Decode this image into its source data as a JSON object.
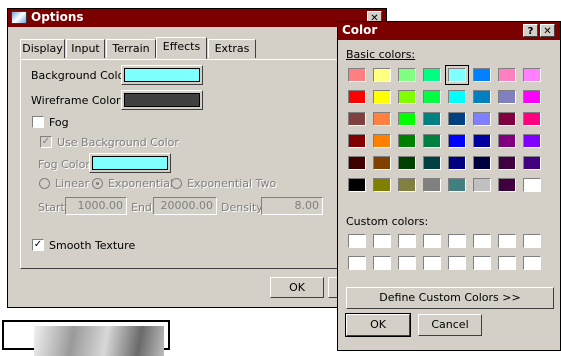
{
  "options_window": {
    "title": "Options",
    "close_glyph": "✕",
    "tabs": [
      {
        "label": "Display",
        "active": false
      },
      {
        "label": "Input",
        "active": false
      },
      {
        "label": "Terrain",
        "active": false
      },
      {
        "label": "Effects",
        "active": true
      },
      {
        "label": "Extras",
        "active": false
      }
    ],
    "background_color_label": "Background Color",
    "background_color": "#80ffff",
    "wireframe_color_label": "Wireframe Color",
    "wireframe_color": "#404040",
    "fog": {
      "label": "Fog",
      "checked": false
    },
    "use_bg_color": {
      "label": "Use Background Color",
      "checked": true,
      "check_glyph": "✓"
    },
    "fog_color_label": "Fog Color",
    "fog_color": "#80ffff",
    "fog_modes": [
      "Linear",
      "Exponential",
      "Exponential Two"
    ],
    "fog_mode_selected": "Exponential",
    "start_label": "Start",
    "start_value": "1000.00",
    "end_label": "End",
    "end_value": "20000.00",
    "density_label": "Density",
    "density_value": "8.00",
    "smooth_texture": {
      "label": "Smooth Texture",
      "checked": true,
      "check_glyph": "✓"
    },
    "ok_label": "OK"
  },
  "color_dialog": {
    "title": "Color",
    "help_glyph": "?",
    "close_glyph": "✕",
    "basic_colors_label": "Basic colors:",
    "basic_colors": [
      [
        "#ff8080",
        "#ffff80",
        "#80ff80",
        "#00ff80",
        "#80ffff",
        "#0080ff",
        "#ff80c0",
        "#ff80ff"
      ],
      [
        "#ff0000",
        "#ffff00",
        "#80ff00",
        "#00ff40",
        "#00ffff",
        "#0080c0",
        "#8080c0",
        "#ff00ff"
      ],
      [
        "#804040",
        "#ff8040",
        "#00ff00",
        "#008080",
        "#004080",
        "#8080ff",
        "#800040",
        "#ff0080"
      ],
      [
        "#800000",
        "#ff8000",
        "#008000",
        "#008040",
        "#0000ff",
        "#0000a0",
        "#800080",
        "#8000ff"
      ],
      [
        "#400000",
        "#804000",
        "#004000",
        "#004040",
        "#000080",
        "#000040",
        "#400040",
        "#400080"
      ],
      [
        "#000000",
        "#808000",
        "#808040",
        "#808080",
        "#408080",
        "#c0c0c0",
        "#400040",
        "#ffffff"
      ]
    ],
    "selected_row": 0,
    "selected_col": 4,
    "custom_colors_label": "Custom colors:",
    "custom_colors": [
      [
        "#ffffff",
        "#ffffff",
        "#ffffff",
        "#ffffff",
        "#ffffff",
        "#ffffff",
        "#ffffff",
        "#ffffff"
      ],
      [
        "#ffffff",
        "#ffffff",
        "#ffffff",
        "#ffffff",
        "#ffffff",
        "#ffffff",
        "#ffffff",
        "#ffffff"
      ]
    ],
    "define_custom_label": "Define Custom Colors >>",
    "ok_label": "OK",
    "cancel_label": "Cancel"
  }
}
